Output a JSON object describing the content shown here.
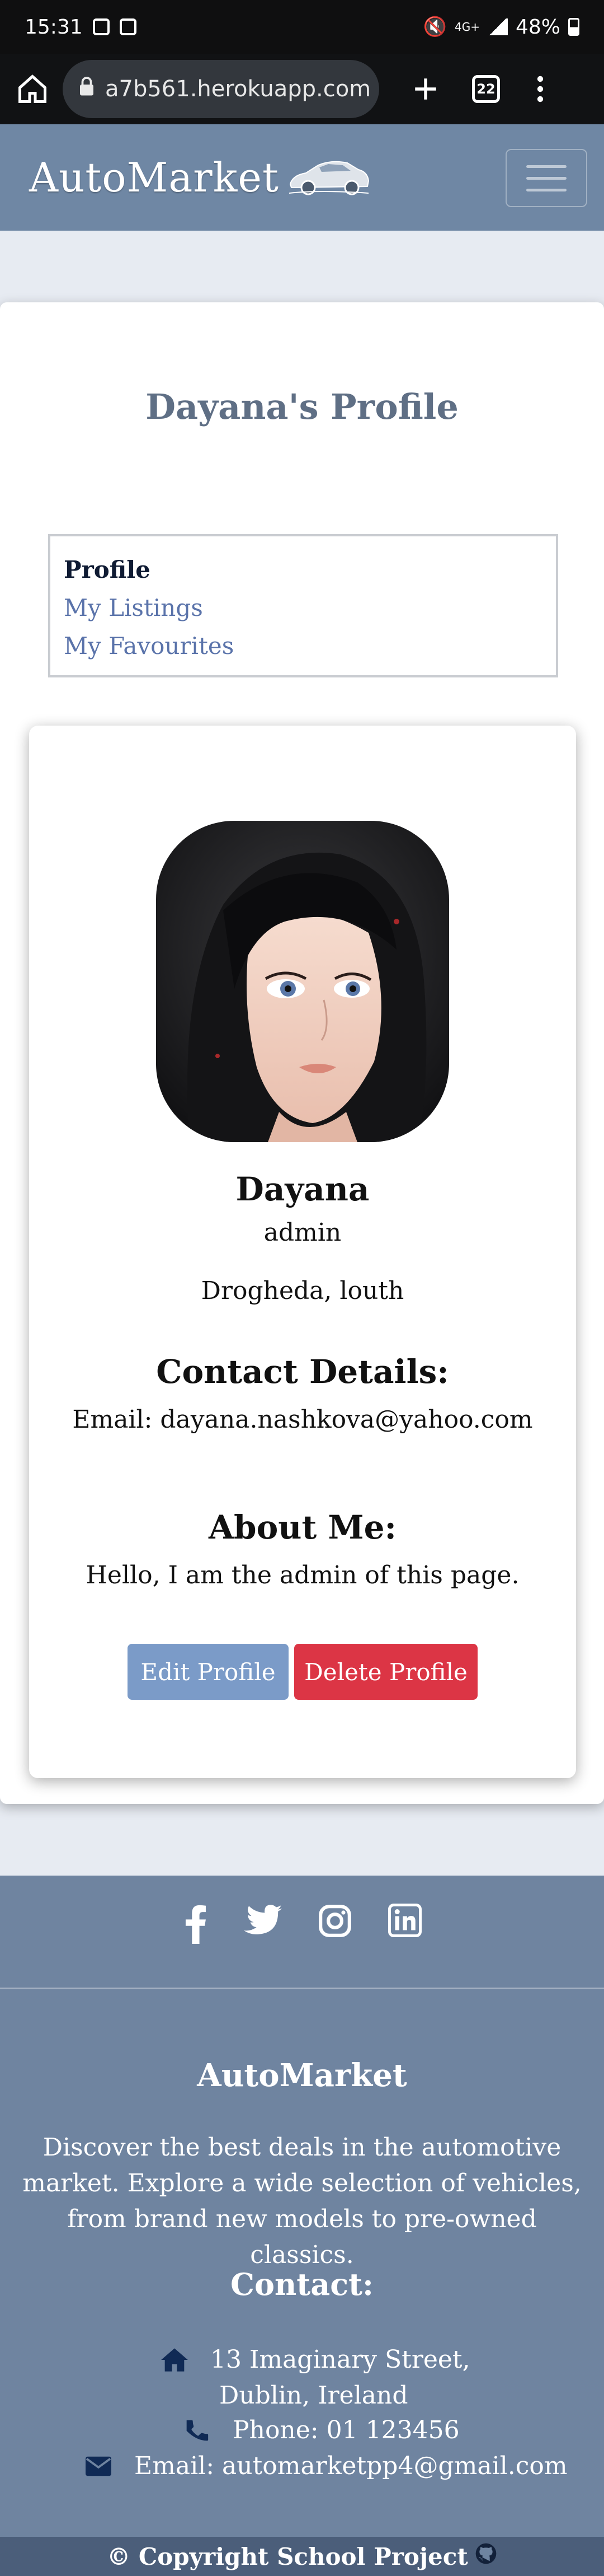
{
  "status_bar": {
    "time": "15:31",
    "network": "4G+",
    "battery": "48%"
  },
  "browser": {
    "url": "a7b561.herokuapp.com",
    "tab_count": "22",
    "icons": [
      "home-icon",
      "lock-icon",
      "plus-icon",
      "tabs-icon",
      "more-icon"
    ]
  },
  "navbar": {
    "brand": "AutoMarket",
    "icons": [
      "car-logo-icon",
      "hamburger-icon"
    ]
  },
  "profile_page": {
    "title": "Dayana's Profile",
    "nav": {
      "profile": "Profile",
      "listings": "My Listings",
      "favourites": "My Favourites"
    },
    "card": {
      "username": "Dayana",
      "role": "admin",
      "location": "Drogheda, louth",
      "contact_heading": "Contact Details:",
      "email_line": "Email: dayana.nashkova@yahoo.com",
      "about_heading": "About Me:",
      "about_text": "Hello, I am the admin of this page.",
      "edit_button": "Edit Profile",
      "delete_button": "Delete Profile"
    }
  },
  "footer": {
    "social_icons": [
      "facebook-icon",
      "twitter-icon",
      "instagram-icon",
      "linkedin-icon"
    ],
    "title": "AutoMarket",
    "description": "Discover the best deals in the automotive market. Explore a wide selection of vehicles, from brand new models to pre-owned classics.",
    "contact_heading": "Contact:",
    "address_line1": "13 Imaginary Street,",
    "address_line2": "Dublin, Ireland",
    "phone": "Phone: 01 123456",
    "email": "Email: automarketpp4@gmail.com",
    "copyright": "© Copyright School Project"
  },
  "colors": {
    "navbar": "#6f87a4",
    "footer": "#6f84a0",
    "edit_button": "#7b9bc8",
    "delete_button": "#dc3545",
    "link": "#5a73aa"
  }
}
